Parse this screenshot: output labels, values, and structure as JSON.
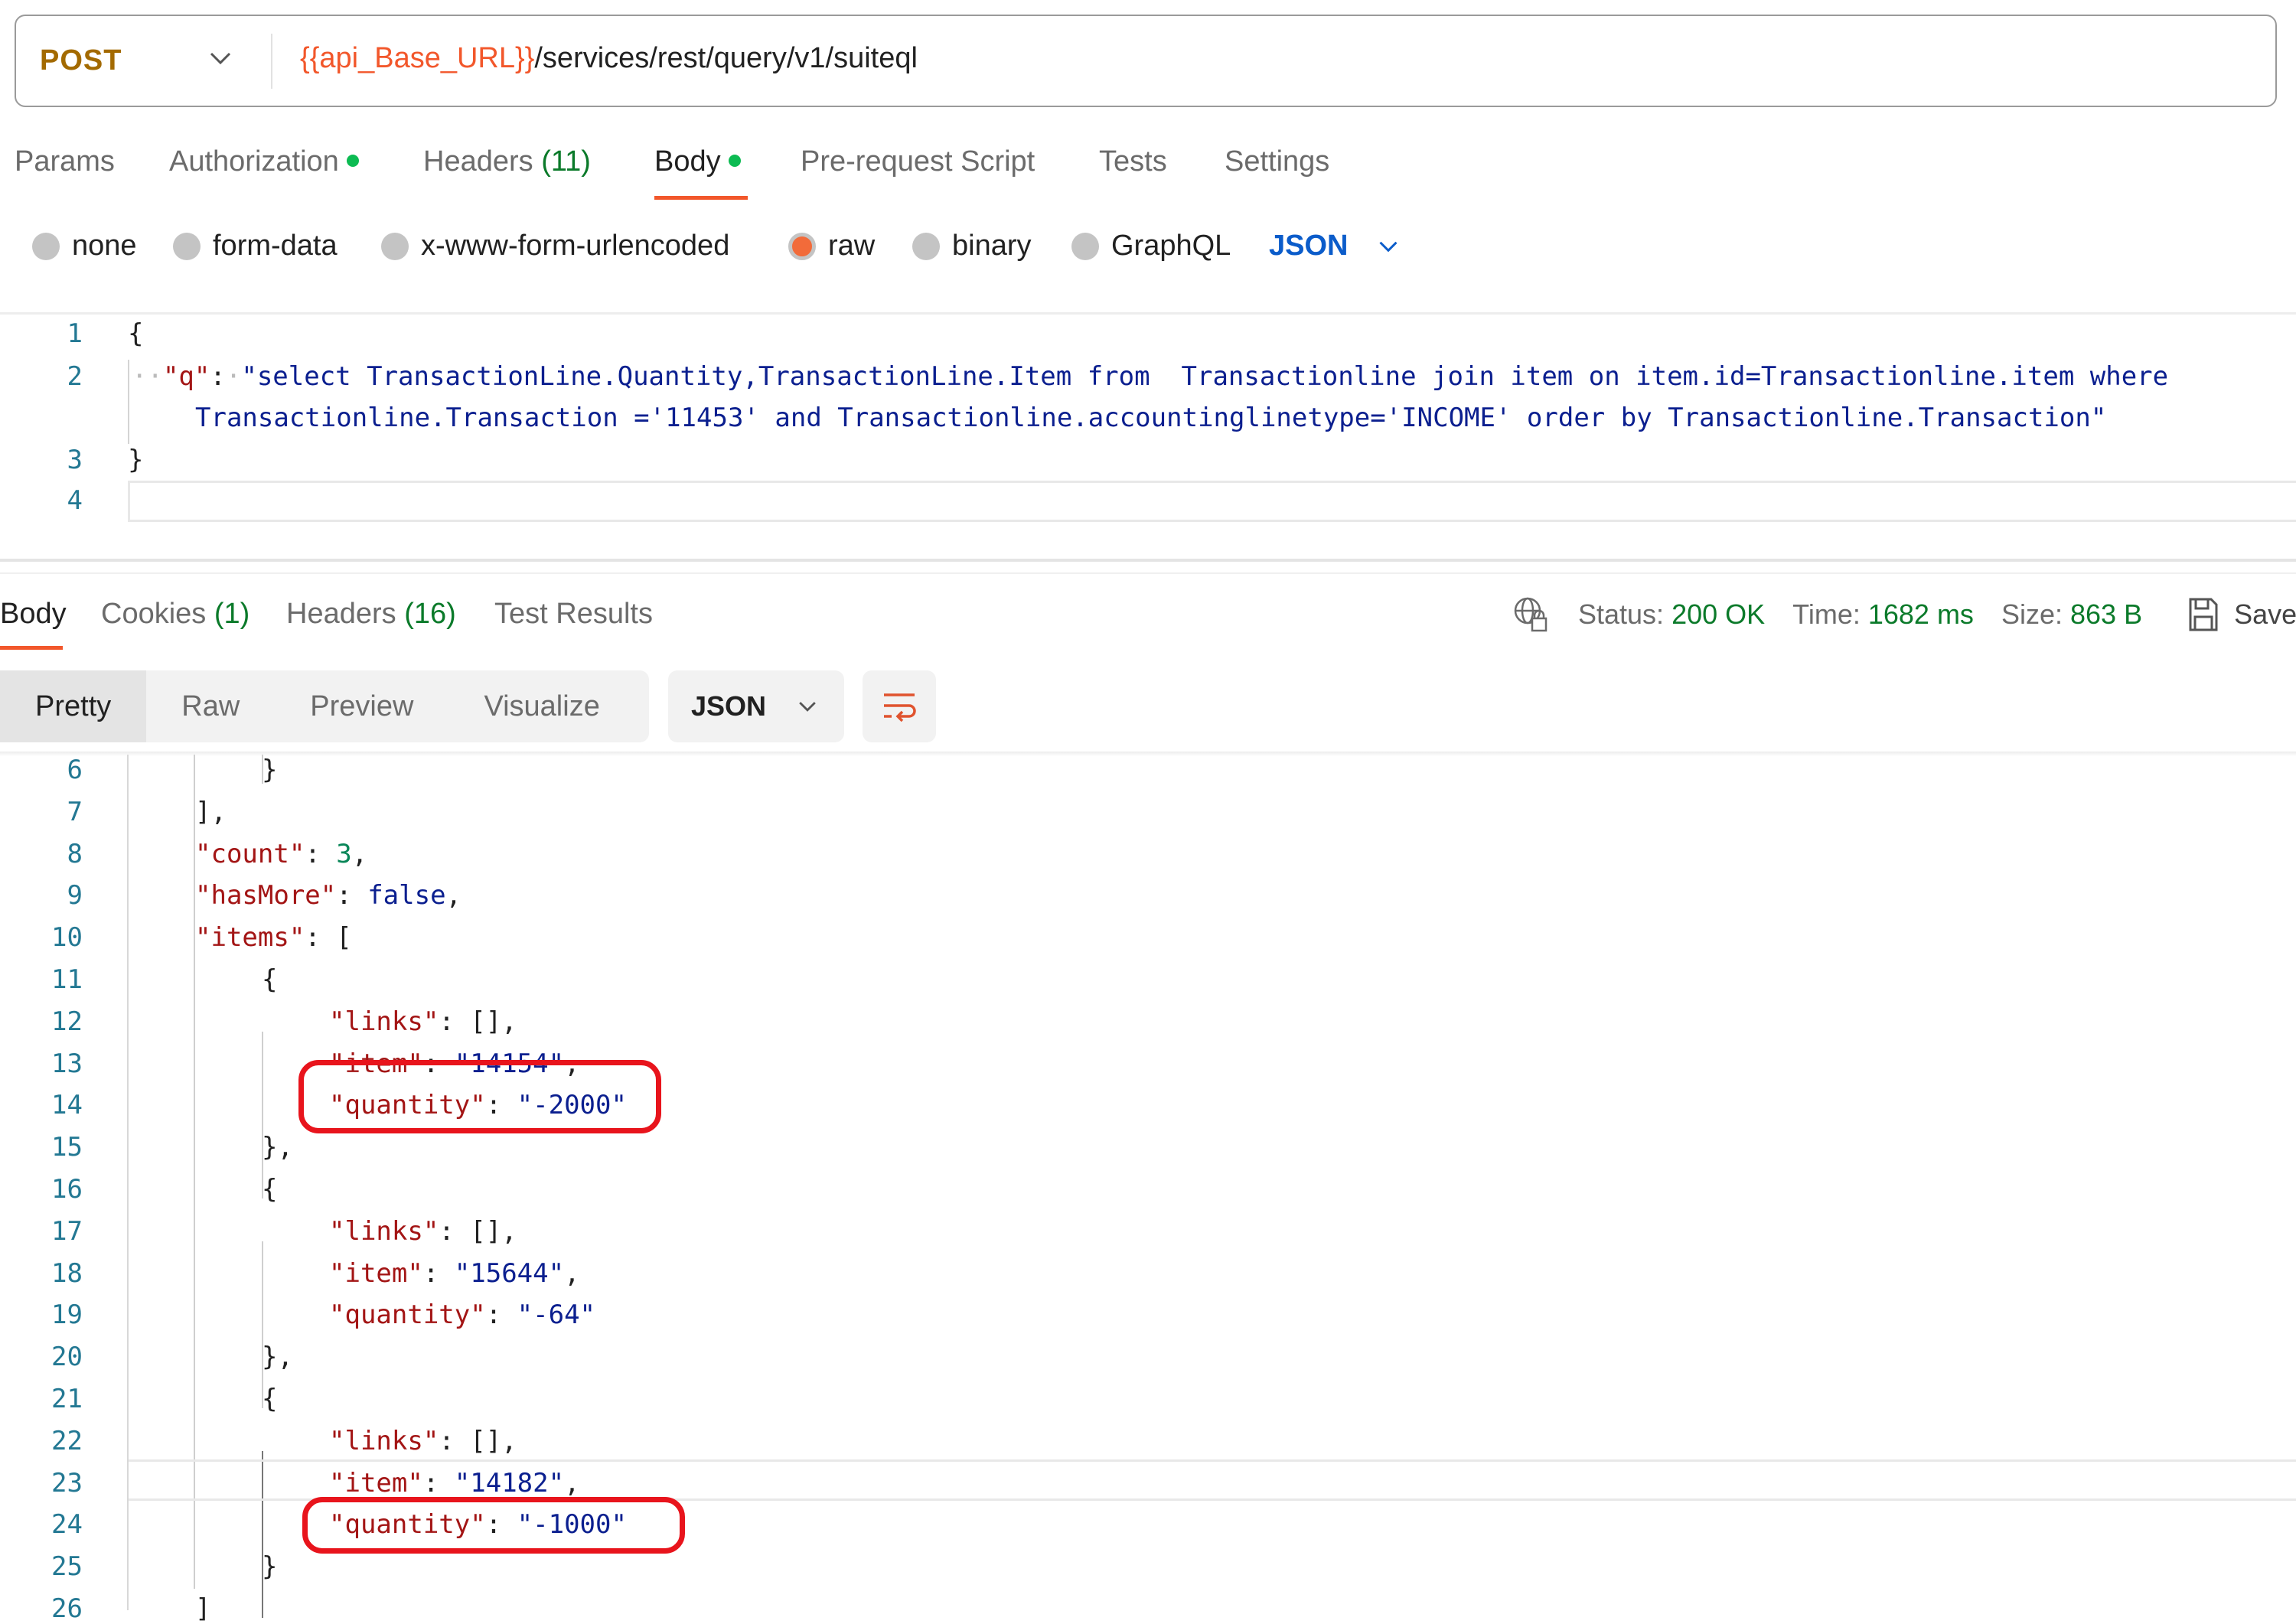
{
  "request": {
    "method": "POST",
    "url_variable": "{{api_Base_URL}}",
    "url_path": "/services/rest/query/v1/suiteql",
    "tabs": [
      {
        "label": "Params",
        "count": null,
        "dot": false,
        "active": false
      },
      {
        "label": "Authorization",
        "count": null,
        "dot": true,
        "active": false
      },
      {
        "label": "Headers",
        "count": "(11)",
        "dot": false,
        "active": false
      },
      {
        "label": "Body",
        "count": null,
        "dot": true,
        "active": true
      },
      {
        "label": "Pre-request Script",
        "count": null,
        "dot": false,
        "active": false
      },
      {
        "label": "Tests",
        "count": null,
        "dot": false,
        "active": false
      },
      {
        "label": "Settings",
        "count": null,
        "dot": false,
        "active": false
      }
    ],
    "body_types": [
      {
        "label": "none",
        "checked": false
      },
      {
        "label": "form-data",
        "checked": false
      },
      {
        "label": "x-www-form-urlencoded",
        "checked": false
      },
      {
        "label": "raw",
        "checked": true
      },
      {
        "label": "binary",
        "checked": false
      },
      {
        "label": "GraphQL",
        "checked": false
      }
    ],
    "body_language": "JSON",
    "editor": {
      "line_numbers": [
        "1",
        "2",
        "3",
        "4"
      ],
      "open_brace": "{",
      "close_brace": "}",
      "key": "\"q\"",
      "colon": ":",
      "query_line1": "\"select TransactionLine.Quantity,TransactionLine.Item from  Transactionline join item on item.id=Transactionline.item where",
      "query_line2": "Transactionline.Transaction ='11453' and Transactionline.accountinglinetype='INCOME' order by Transactionline.Transaction\""
    }
  },
  "response": {
    "tabs": [
      {
        "label": "Body",
        "count": null,
        "active": true
      },
      {
        "label": "Cookies",
        "count": "(1)",
        "active": false
      },
      {
        "label": "Headers",
        "count": "(16)",
        "active": false
      },
      {
        "label": "Test Results",
        "count": null,
        "active": false
      }
    ],
    "status_label": "Status:",
    "status_value": "200 OK",
    "time_label": "Time:",
    "time_value": "1682 ms",
    "size_label": "Size:",
    "size_value": "863 B",
    "save_label": "Save",
    "view_modes": [
      {
        "label": "Pretty",
        "active": true
      },
      {
        "label": "Raw",
        "active": false
      },
      {
        "label": "Preview",
        "active": false
      },
      {
        "label": "Visualize",
        "active": false
      }
    ],
    "format": "JSON",
    "lines": [
      {
        "n": "6",
        "indent": 2,
        "tokens": [
          [
            "p",
            "}"
          ]
        ]
      },
      {
        "n": "7",
        "indent": 1,
        "tokens": [
          [
            "p",
            "],"
          ]
        ]
      },
      {
        "n": "8",
        "indent": 1,
        "tokens": [
          [
            "k",
            "\"count\""
          ],
          [
            "p",
            ": "
          ],
          [
            "num",
            "3"
          ],
          [
            "p",
            ","
          ]
        ]
      },
      {
        "n": "9",
        "indent": 1,
        "tokens": [
          [
            "k",
            "\"hasMore\""
          ],
          [
            "p",
            ": "
          ],
          [
            "kw",
            "false"
          ],
          [
            "p",
            ","
          ]
        ]
      },
      {
        "n": "10",
        "indent": 1,
        "tokens": [
          [
            "k",
            "\"items\""
          ],
          [
            "p",
            ": ["
          ]
        ]
      },
      {
        "n": "11",
        "indent": 2,
        "tokens": [
          [
            "p",
            "{"
          ]
        ]
      },
      {
        "n": "12",
        "indent": 3,
        "tokens": [
          [
            "k",
            "\"links\""
          ],
          [
            "p",
            ": [],"
          ]
        ]
      },
      {
        "n": "13",
        "indent": 3,
        "tokens": [
          [
            "k",
            "\"item\""
          ],
          [
            "p",
            ": "
          ],
          [
            "s",
            "\"14154\""
          ],
          [
            "p",
            ","
          ]
        ]
      },
      {
        "n": "14",
        "indent": 3,
        "tokens": [
          [
            "k",
            "\"quantity\""
          ],
          [
            "p",
            ": "
          ],
          [
            "s",
            "\"-2000\""
          ]
        ]
      },
      {
        "n": "15",
        "indent": 2,
        "tokens": [
          [
            "p",
            "},"
          ]
        ]
      },
      {
        "n": "16",
        "indent": 2,
        "tokens": [
          [
            "p",
            "{"
          ]
        ]
      },
      {
        "n": "17",
        "indent": 3,
        "tokens": [
          [
            "k",
            "\"links\""
          ],
          [
            "p",
            ": [],"
          ]
        ]
      },
      {
        "n": "18",
        "indent": 3,
        "tokens": [
          [
            "k",
            "\"item\""
          ],
          [
            "p",
            ": "
          ],
          [
            "s",
            "\"15644\""
          ],
          [
            "p",
            ","
          ]
        ]
      },
      {
        "n": "19",
        "indent": 3,
        "tokens": [
          [
            "k",
            "\"quantity\""
          ],
          [
            "p",
            ": "
          ],
          [
            "s",
            "\"-64\""
          ]
        ]
      },
      {
        "n": "20",
        "indent": 2,
        "tokens": [
          [
            "p",
            "},"
          ]
        ]
      },
      {
        "n": "21",
        "indent": 2,
        "tokens": [
          [
            "p",
            "{"
          ]
        ]
      },
      {
        "n": "22",
        "indent": 3,
        "tokens": [
          [
            "k",
            "\"links\""
          ],
          [
            "p",
            ": [],"
          ]
        ]
      },
      {
        "n": "23",
        "indent": 3,
        "tokens": [
          [
            "k",
            "\"item\""
          ],
          [
            "p",
            ": "
          ],
          [
            "s",
            "\"14182\""
          ],
          [
            "p",
            ","
          ]
        ]
      },
      {
        "n": "24",
        "indent": 3,
        "tokens": [
          [
            "k",
            "\"quantity\""
          ],
          [
            "p",
            ": "
          ],
          [
            "s",
            "\"-1000\""
          ]
        ]
      },
      {
        "n": "25",
        "indent": 2,
        "tokens": [
          [
            "p",
            "}"
          ]
        ]
      },
      {
        "n": "26",
        "indent": 1,
        "tokens": [
          [
            "p",
            "]"
          ]
        ]
      }
    ],
    "annotations": [
      {
        "line": "14",
        "label": "quantity -2000 highlighted"
      },
      {
        "line": "24",
        "label": "quantity -1000 highlighted"
      }
    ]
  },
  "colors": {
    "accent": "#F2572B",
    "method": "#A36A00",
    "status_ok": "#0b7a2a",
    "dot": "#0cbb52",
    "link_blue": "#0B5CCA",
    "annotation_red": "#E8141C",
    "json_key": "#A31515",
    "json_string": "#0B1F8F"
  }
}
